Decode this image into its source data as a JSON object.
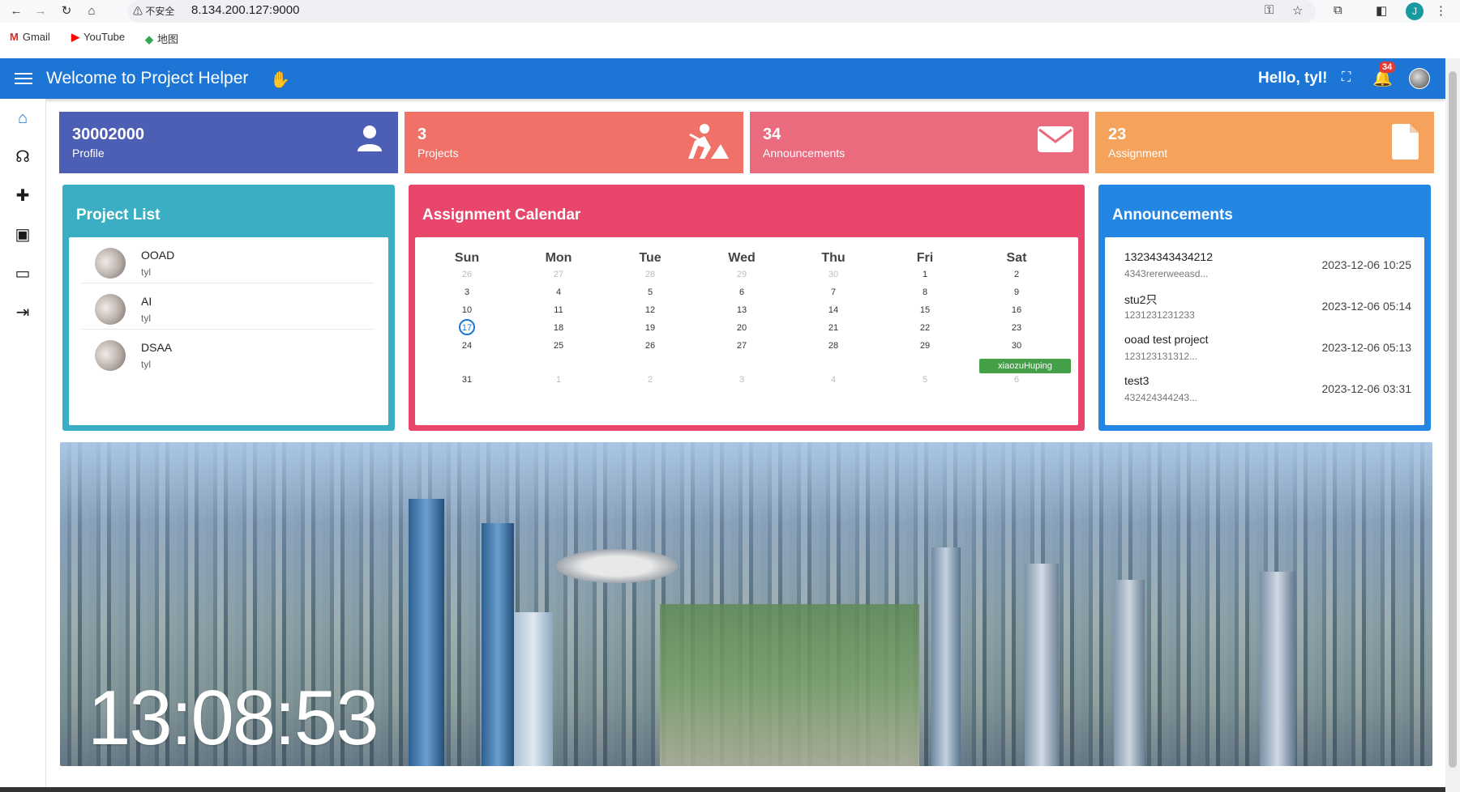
{
  "browser": {
    "nav": {
      "back": "←",
      "forward": "→",
      "reload": "↻",
      "home": "⌂"
    },
    "security_label": "⚠ 不安全",
    "url": "8.134.200.127:9000",
    "profile_initial": "J",
    "bookmarks": [
      {
        "label": "Gmail",
        "icon": "gmail-icon",
        "glyph": "M",
        "color": "#d93025"
      },
      {
        "label": "YouTube",
        "icon": "youtube-icon",
        "glyph": "▶",
        "color": "#ff0000"
      },
      {
        "label": "地图",
        "icon": "maps-icon",
        "glyph": "◆",
        "color": "#34a853"
      }
    ]
  },
  "appbar": {
    "title": "Welcome to Project Helper",
    "greeting": "Hello, tyl!",
    "notification_count": "34",
    "color": "#1d76d6"
  },
  "sidebar": {
    "items": [
      {
        "name": "home-icon",
        "glyph": "⌂"
      },
      {
        "name": "speaker-person-icon",
        "glyph": "☊"
      },
      {
        "name": "puzzle-icon",
        "glyph": "✚"
      },
      {
        "name": "contact-card-icon",
        "glyph": "▣"
      },
      {
        "name": "cast-icon",
        "glyph": "▭"
      },
      {
        "name": "logout-icon",
        "glyph": "⇥"
      }
    ]
  },
  "stats": [
    {
      "value": "30002000",
      "label": "Profile",
      "icon": "person-icon",
      "glyph": "👤",
      "color": "#4d5eb5"
    },
    {
      "value": "3",
      "label": "Projects",
      "icon": "digging-icon",
      "glyph": "⛏",
      "color": "#f07167"
    },
    {
      "value": "34",
      "label": "Announcements",
      "icon": "mail-icon",
      "glyph": "✉",
      "color": "#ea6a7e"
    },
    {
      "value": "23",
      "label": "Assignment",
      "icon": "document-icon",
      "glyph": "📄",
      "color": "#f5a25d"
    }
  ],
  "project_list": {
    "title": "Project List",
    "color": "#3aafc4",
    "items": [
      {
        "name": "OOAD",
        "owner": "tyl"
      },
      {
        "name": "AI",
        "owner": "tyl"
      },
      {
        "name": "DSAA",
        "owner": "tyl"
      }
    ]
  },
  "calendar": {
    "title": "Assignment Calendar",
    "color": "#e8466a",
    "weekdays": [
      "Sun",
      "Mon",
      "Tue",
      "Wed",
      "Thu",
      "Fri",
      "Sat"
    ],
    "weeks": [
      [
        "26",
        "27",
        "28",
        "29",
        "30",
        "1",
        "2"
      ],
      [
        "3",
        "4",
        "5",
        "6",
        "7",
        "8",
        "9"
      ],
      [
        "10",
        "11",
        "12",
        "13",
        "14",
        "15",
        "16"
      ],
      [
        "17",
        "18",
        "19",
        "20",
        "21",
        "22",
        "23"
      ],
      [
        "24",
        "25",
        "26",
        "27",
        "28",
        "29",
        "30"
      ],
      [
        "31",
        "1",
        "2",
        "3",
        "4",
        "5",
        "6"
      ]
    ],
    "today": "17",
    "event": "xiaozuHuping"
  },
  "announcements": {
    "title": "Announcements",
    "color": "#2386e2",
    "items": [
      {
        "title": "13234343434212",
        "desc": "4343rererweeasd...",
        "time": "2023-12-06 10:25"
      },
      {
        "title": "stu2只",
        "desc": "1231231231233",
        "time": "2023-12-06 05:14"
      },
      {
        "title": "ooad test project",
        "desc": "123123131312...",
        "time": "2023-12-06 05:13"
      },
      {
        "title": "test3",
        "desc": "432424344243...",
        "time": "2023-12-06 03:31"
      }
    ]
  },
  "banner": {
    "clock": "13:08:53"
  }
}
